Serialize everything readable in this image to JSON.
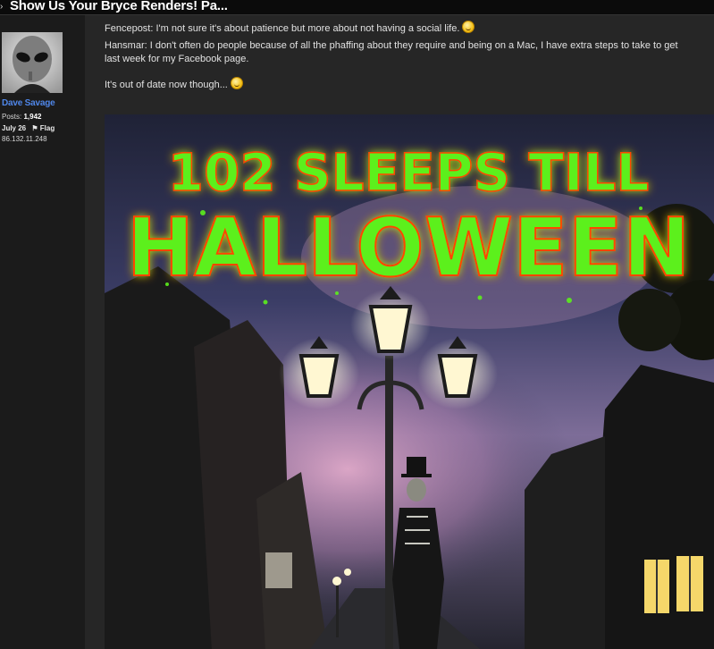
{
  "thread": {
    "title": "Show Us Your Bryce Renders! Pa..."
  },
  "post": {
    "author": {
      "name": "Dave Savage",
      "posts_label": "Posts:",
      "posts_count": "1,942",
      "date": "July 26",
      "flag_label": "Flag",
      "ip": "86.132.11.248"
    },
    "paragraphs": {
      "p1": "Fencepost: I'm not sure it's about patience but more about not having a social life.",
      "p2a": "Hansmar: I don't often do people because of all the phaffing about they require and being on a Mac, I have extra steps to take to get",
      "p2b": "last week for my Facebook page.",
      "p3": "It's out of date now though..."
    },
    "emojis": [
      "smile-emoji",
      "grin-emoji"
    ],
    "image": {
      "headline_line1": "102 SLEEPS TILL",
      "headline_line2": "HALLOWEEN",
      "headline_color": "#5cf01c",
      "glow_color": "#ff4400"
    }
  },
  "colors": {
    "page_bg": "#262626",
    "sidebar_bg": "#1b1b1b",
    "username": "#4f86e8"
  }
}
